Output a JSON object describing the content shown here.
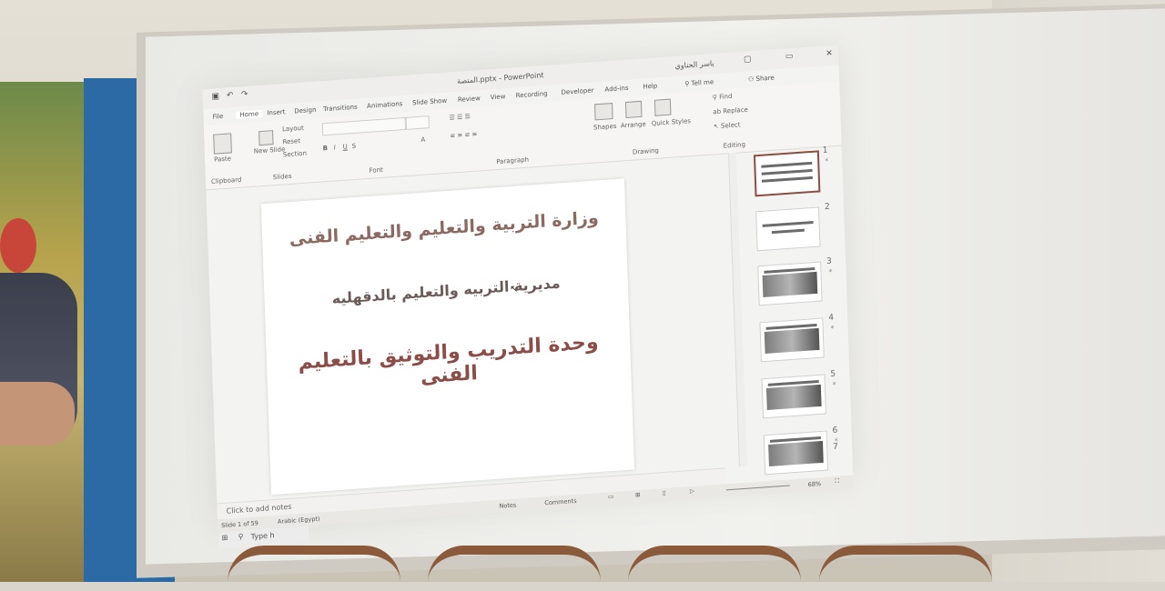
{
  "titlebar": {
    "file_name": "المنصة.pptx",
    "app_name": "PowerPoint",
    "user_name": "ياسر الحناوي",
    "tell_me": "Tell me",
    "share": "Share"
  },
  "menu": {
    "items": [
      "File",
      "Home",
      "Insert",
      "Design",
      "Transitions",
      "Animations",
      "Slide Show",
      "Review",
      "View",
      "Recording",
      "Developer",
      "Add-ins",
      "Help"
    ]
  },
  "ribbon": {
    "paste": "Paste",
    "clipboard": "Clipboard",
    "new_slide": "New Slide",
    "layout": "Layout",
    "reset": "Reset",
    "section": "Section",
    "slides": "Slides",
    "font": "Font",
    "paragraph": "Paragraph",
    "shapes": "Shapes",
    "arrange": "Arrange",
    "quick_styles": "Quick Styles",
    "drawing": "Drawing",
    "find": "Find",
    "replace": "Replace",
    "select": "Select",
    "editing": "Editing"
  },
  "slide": {
    "line1": "وزارة التربية والتعليم والتعليم الفنى",
    "line2": "مديرية التربيه والتعليم بالدقهليه",
    "line3": "وحدة التدريب والتوثيق بالتعليم الفنى"
  },
  "notes_placeholder": "Click to add notes",
  "status": {
    "slide_indicator": "Slide 1 of 59",
    "language": "Arabic (Egypt)",
    "notes": "Notes",
    "comments": "Comments",
    "zoom": "68%"
  },
  "thumbnails": [
    "1",
    "2",
    "3",
    "4",
    "5",
    "6",
    "7"
  ],
  "taskbar": {
    "search_placeholder": "Type h"
  }
}
